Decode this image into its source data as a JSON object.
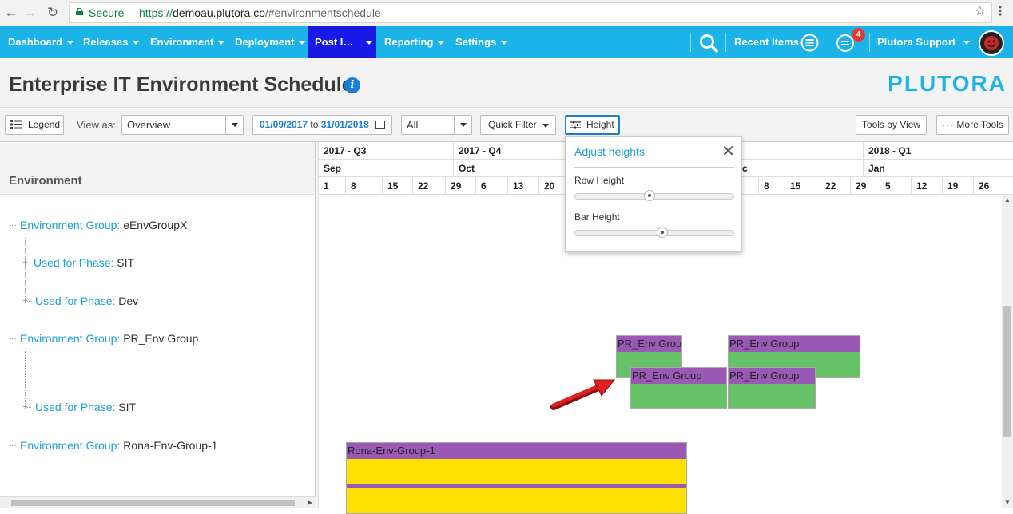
{
  "browser": {
    "secure_label": "Secure",
    "url_scheme": "https://",
    "url_host": "demoau.plutora.co",
    "url_path": "/#environmentschedule"
  },
  "nav": {
    "items": [
      {
        "label": "Dashboard"
      },
      {
        "label": "Releases"
      },
      {
        "label": "Environment"
      },
      {
        "label": "Deployment"
      },
      {
        "label": "Post I…"
      },
      {
        "label": "Reporting"
      },
      {
        "label": "Settings"
      }
    ],
    "recent_items": "Recent Items",
    "notification_count": "4",
    "user": "Plutora Support",
    "accent": "#1cb3e8",
    "active_color": "#1a1ae6"
  },
  "header": {
    "title": "Enterprise IT Environment Schedule",
    "brand": "PLUTORA"
  },
  "toolbar": {
    "legend": "Legend",
    "view_as_label": "View as:",
    "view_as_value": "Overview",
    "date_from": "01/09/2017",
    "date_to_word": "to",
    "date_to": "31/01/2018",
    "filter_value": "All",
    "quick_filter": "Quick Filter",
    "height": "Height",
    "tools_by_view": "Tools by View",
    "more_tools": "More Tools"
  },
  "left": {
    "header": "Environment",
    "tree": [
      {
        "key": "Environment Group:",
        "value": "eEnvGroupX"
      },
      {
        "key": "Used for Phase:",
        "value": "SIT"
      },
      {
        "key": "Used for Phase:",
        "value": "Dev"
      },
      {
        "key": "Environment Group:",
        "value": "PR_Env Group"
      },
      {
        "key": "Used for Phase:",
        "value": "SIT"
      },
      {
        "key": "Environment Group:",
        "value": "Rona-Env-Group-1"
      }
    ]
  },
  "timeline": {
    "quarters": [
      "2017 - Q3",
      "2017 - Q4",
      "2018 - Q1"
    ],
    "months": [
      "Sep",
      "Oct",
      "c",
      "Jan"
    ],
    "days": [
      "1",
      "8",
      "15",
      "22",
      "29",
      "6",
      "13",
      "20",
      "8",
      "15",
      "22",
      "29",
      "5",
      "12",
      "19",
      "26"
    ],
    "bars": [
      {
        "label": "PR_Env Grou",
        "body_color": "#66c266"
      },
      {
        "label": "PR_Env Group",
        "body_color": "#66c266"
      },
      {
        "label": "PR_Env Group",
        "body_color": "#66c266"
      },
      {
        "label": "PR_Env Group",
        "body_color": "#66c266"
      },
      {
        "label": "Rona-Env-Group-1",
        "body_color": "#ffe000"
      }
    ],
    "bar_header_color": "#9b59b6"
  },
  "height_popup": {
    "title": "Adjust heights",
    "row_height_label": "Row Height",
    "row_height_value": 0.46,
    "bar_height_label": "Bar Height",
    "bar_height_value": 0.55
  }
}
